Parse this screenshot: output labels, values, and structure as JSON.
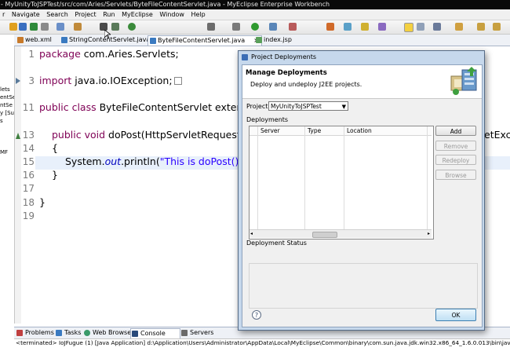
{
  "window": {
    "title": "- MyUnityToJSPTest/src/com/Aries/Servlets/ByteFileContentServlet.java - MyEclipse Enterprise Workbench"
  },
  "menu": [
    "r",
    "Navigate",
    "Search",
    "Project",
    "Run",
    "MyEclipse",
    "Window",
    "Help"
  ],
  "editor_tabs": [
    {
      "label": "web.xml",
      "active": false
    },
    {
      "label": "StringContentServlet.java",
      "active": false
    },
    {
      "label": "ByteFileContentServlet.java",
      "active": true,
      "close": "×"
    },
    {
      "label": "index.jsp",
      "active": false
    }
  ],
  "left_panel": [
    "lets",
    "entSe",
    "ntSe",
    "y [Su",
    "s",
    "MF"
  ],
  "code": {
    "line_numbers": [
      "1",
      "3",
      "11",
      "13",
      "14",
      "15",
      "16",
      "17",
      "18",
      "19"
    ],
    "l1_kw": "package",
    "l1_rest": " com.Aries.Servlets;",
    "l3_kw": "import",
    "l3_rest": " java.io.IOException;",
    "l11_kw": "public class",
    "l11_rest": " ByteFileContentServlet extends",
    "l13_kw": "public void",
    "l13_rest": " doPost(HttpServletRequest r",
    "l13_right": "etExcep",
    "l14": "{",
    "l15_a": "System.",
    "l15_field": "out",
    "l15_b": ".println(",
    "l15_str": "\"This is doPost()\"",
    "l15_c": ");",
    "l16": "}",
    "l18": "}"
  },
  "bottom_tabs": [
    "Problems",
    "Tasks",
    "Web Browser",
    "Console",
    "Servers"
  ],
  "bottom_active_tab": "Console",
  "console_text": "<terminated> IoJFugue (1) [Java Application] d:\\Application\\Users\\Administrator\\AppData\\Local\\MyEclipse\\Common\\binary\\com.sun.java.jdk.win32.x86_64_1.6.0.013\\bin\\javaw.exe (2016-",
  "dialog": {
    "title": "Project Deployments",
    "heading": "Manage Deployments",
    "subheading": "Deploy and undeploy J2EE projects.",
    "project_label": "Project",
    "project_value": "MyUnityToJSPTest",
    "deployments_label": "Deployments",
    "columns": [
      "Server",
      "Type",
      "Location"
    ],
    "buttons": {
      "add": "Add",
      "remove": "Remove",
      "redeploy": "Redeploy",
      "browse": "Browse"
    },
    "status_label": "Deployment Status",
    "help": "?",
    "ok": "OK"
  },
  "colors": {
    "keyword": "#7f0055",
    "string": "#2a00ff",
    "field": "#0000c0",
    "dialog_frame": "#c6d8ec"
  }
}
